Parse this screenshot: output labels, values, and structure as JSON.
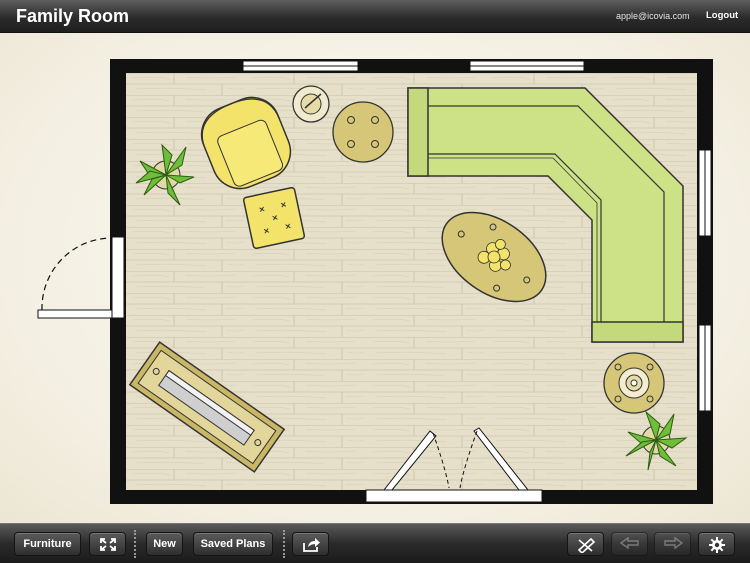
{
  "header": {
    "title": "Family Room",
    "user_email": "apple@icovia.com",
    "logout_label": "Logout"
  },
  "toolbar": {
    "furniture_label": "Furniture",
    "fit_icon": "expand-arrows-icon",
    "new_label": "New",
    "saved_plans_label": "Saved Plans",
    "share_icon": "share-icon",
    "tools_icon": "ruler-pencil-icon",
    "undo_icon": "undo-arrow-icon",
    "redo_icon": "redo-arrow-icon",
    "settings_icon": "gear-icon"
  },
  "plan": {
    "room_name": "Family Room",
    "floor": "light wood plank",
    "colors": {
      "wall": "#111111",
      "floor": "#e4ddc7",
      "sofa": "#cde287",
      "chair": "#f3e36a",
      "table": "#d6c778",
      "rug": "#c9b766",
      "plant": "#6dbe3a"
    }
  }
}
